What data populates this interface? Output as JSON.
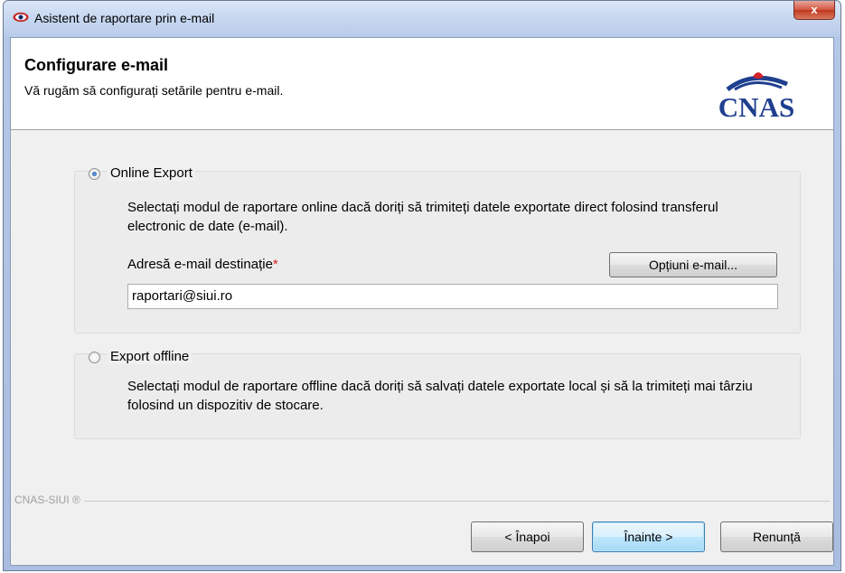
{
  "window": {
    "title": "Asistent de raportare prin e-mail",
    "close_label": "x"
  },
  "header": {
    "title": "Configurare e-mail",
    "subtitle": "Vă rugăm să configurați setările pentru e-mail.",
    "logo_text": "CNAS"
  },
  "online": {
    "label": "Online Export",
    "selected": true,
    "description": "Selectați modul de raportare online dacă doriți să trimiteți datele exportate direct folosind transferul electronic de date (e-mail).",
    "address_label": "Adresă e-mail destinație",
    "required_mark": "*",
    "options_button": "Opțiuni e-mail...",
    "email_value": "raportari@siui.ro"
  },
  "offline": {
    "label": "Export offline",
    "selected": false,
    "description": "Selectați modul de raportare offline dacă doriți să salvați datele exportate local și să la trimiteți mai târziu folosind un dispozitiv de stocare."
  },
  "footer": {
    "brand": "CNAS-SIUI ®",
    "back_button": "< Înapoi",
    "next_button": "Înainte >",
    "cancel_button": "Renunță"
  },
  "colors": {
    "accent_red": "#d62020",
    "logo_blue": "#1f3f8f",
    "logo_red": "#d0252b"
  }
}
